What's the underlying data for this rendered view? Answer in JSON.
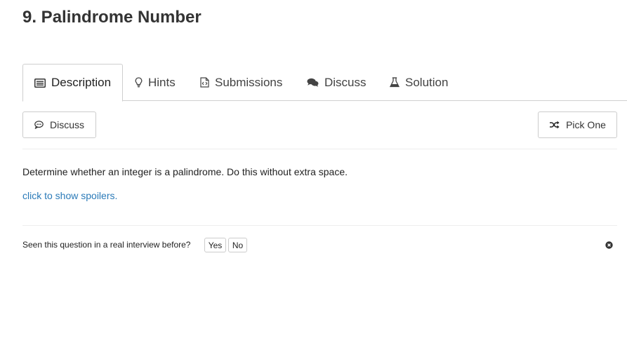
{
  "problem": {
    "title": "9. Palindrome Number"
  },
  "tabs": [
    {
      "label": "Description",
      "icon": "list-alt-icon"
    },
    {
      "label": "Hints",
      "icon": "lightbulb-icon"
    },
    {
      "label": "Submissions",
      "icon": "code-file-icon"
    },
    {
      "label": "Discuss",
      "icon": "comments-icon"
    },
    {
      "label": "Solution",
      "icon": "flask-icon"
    }
  ],
  "toolbar": {
    "discuss_label": "Discuss",
    "pick_one_label": "Pick One"
  },
  "content": {
    "description": "Determine whether an integer is a palindrome. Do this without extra space.",
    "spoiler_link": "click to show spoilers."
  },
  "interview": {
    "question": "Seen this question in a real interview before?",
    "yes_label": "Yes",
    "no_label": "No"
  },
  "colors": {
    "link": "#2a7ab8",
    "border": "#cccccc"
  }
}
